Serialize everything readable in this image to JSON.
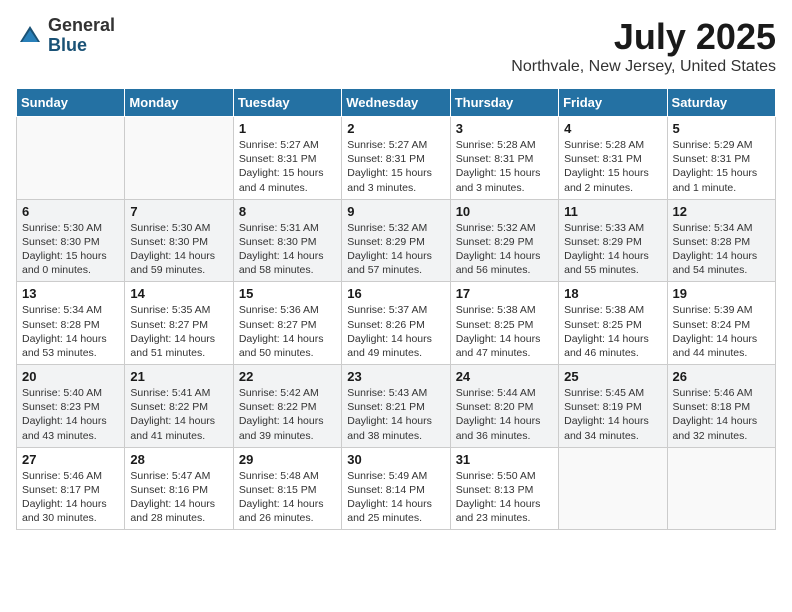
{
  "logo": {
    "general": "General",
    "blue": "Blue"
  },
  "title": "July 2025",
  "location": "Northvale, New Jersey, United States",
  "days_of_week": [
    "Sunday",
    "Monday",
    "Tuesday",
    "Wednesday",
    "Thursday",
    "Friday",
    "Saturday"
  ],
  "weeks": [
    [
      {
        "day": "",
        "info": ""
      },
      {
        "day": "",
        "info": ""
      },
      {
        "day": "1",
        "info": "Sunrise: 5:27 AM\nSunset: 8:31 PM\nDaylight: 15 hours\nand 4 minutes."
      },
      {
        "day": "2",
        "info": "Sunrise: 5:27 AM\nSunset: 8:31 PM\nDaylight: 15 hours\nand 3 minutes."
      },
      {
        "day": "3",
        "info": "Sunrise: 5:28 AM\nSunset: 8:31 PM\nDaylight: 15 hours\nand 3 minutes."
      },
      {
        "day": "4",
        "info": "Sunrise: 5:28 AM\nSunset: 8:31 PM\nDaylight: 15 hours\nand 2 minutes."
      },
      {
        "day": "5",
        "info": "Sunrise: 5:29 AM\nSunset: 8:31 PM\nDaylight: 15 hours\nand 1 minute."
      }
    ],
    [
      {
        "day": "6",
        "info": "Sunrise: 5:30 AM\nSunset: 8:30 PM\nDaylight: 15 hours\nand 0 minutes."
      },
      {
        "day": "7",
        "info": "Sunrise: 5:30 AM\nSunset: 8:30 PM\nDaylight: 14 hours\nand 59 minutes."
      },
      {
        "day": "8",
        "info": "Sunrise: 5:31 AM\nSunset: 8:30 PM\nDaylight: 14 hours\nand 58 minutes."
      },
      {
        "day": "9",
        "info": "Sunrise: 5:32 AM\nSunset: 8:29 PM\nDaylight: 14 hours\nand 57 minutes."
      },
      {
        "day": "10",
        "info": "Sunrise: 5:32 AM\nSunset: 8:29 PM\nDaylight: 14 hours\nand 56 minutes."
      },
      {
        "day": "11",
        "info": "Sunrise: 5:33 AM\nSunset: 8:29 PM\nDaylight: 14 hours\nand 55 minutes."
      },
      {
        "day": "12",
        "info": "Sunrise: 5:34 AM\nSunset: 8:28 PM\nDaylight: 14 hours\nand 54 minutes."
      }
    ],
    [
      {
        "day": "13",
        "info": "Sunrise: 5:34 AM\nSunset: 8:28 PM\nDaylight: 14 hours\nand 53 minutes."
      },
      {
        "day": "14",
        "info": "Sunrise: 5:35 AM\nSunset: 8:27 PM\nDaylight: 14 hours\nand 51 minutes."
      },
      {
        "day": "15",
        "info": "Sunrise: 5:36 AM\nSunset: 8:27 PM\nDaylight: 14 hours\nand 50 minutes."
      },
      {
        "day": "16",
        "info": "Sunrise: 5:37 AM\nSunset: 8:26 PM\nDaylight: 14 hours\nand 49 minutes."
      },
      {
        "day": "17",
        "info": "Sunrise: 5:38 AM\nSunset: 8:25 PM\nDaylight: 14 hours\nand 47 minutes."
      },
      {
        "day": "18",
        "info": "Sunrise: 5:38 AM\nSunset: 8:25 PM\nDaylight: 14 hours\nand 46 minutes."
      },
      {
        "day": "19",
        "info": "Sunrise: 5:39 AM\nSunset: 8:24 PM\nDaylight: 14 hours\nand 44 minutes."
      }
    ],
    [
      {
        "day": "20",
        "info": "Sunrise: 5:40 AM\nSunset: 8:23 PM\nDaylight: 14 hours\nand 43 minutes."
      },
      {
        "day": "21",
        "info": "Sunrise: 5:41 AM\nSunset: 8:22 PM\nDaylight: 14 hours\nand 41 minutes."
      },
      {
        "day": "22",
        "info": "Sunrise: 5:42 AM\nSunset: 8:22 PM\nDaylight: 14 hours\nand 39 minutes."
      },
      {
        "day": "23",
        "info": "Sunrise: 5:43 AM\nSunset: 8:21 PM\nDaylight: 14 hours\nand 38 minutes."
      },
      {
        "day": "24",
        "info": "Sunrise: 5:44 AM\nSunset: 8:20 PM\nDaylight: 14 hours\nand 36 minutes."
      },
      {
        "day": "25",
        "info": "Sunrise: 5:45 AM\nSunset: 8:19 PM\nDaylight: 14 hours\nand 34 minutes."
      },
      {
        "day": "26",
        "info": "Sunrise: 5:46 AM\nSunset: 8:18 PM\nDaylight: 14 hours\nand 32 minutes."
      }
    ],
    [
      {
        "day": "27",
        "info": "Sunrise: 5:46 AM\nSunset: 8:17 PM\nDaylight: 14 hours\nand 30 minutes."
      },
      {
        "day": "28",
        "info": "Sunrise: 5:47 AM\nSunset: 8:16 PM\nDaylight: 14 hours\nand 28 minutes."
      },
      {
        "day": "29",
        "info": "Sunrise: 5:48 AM\nSunset: 8:15 PM\nDaylight: 14 hours\nand 26 minutes."
      },
      {
        "day": "30",
        "info": "Sunrise: 5:49 AM\nSunset: 8:14 PM\nDaylight: 14 hours\nand 25 minutes."
      },
      {
        "day": "31",
        "info": "Sunrise: 5:50 AM\nSunset: 8:13 PM\nDaylight: 14 hours\nand 23 minutes."
      },
      {
        "day": "",
        "info": ""
      },
      {
        "day": "",
        "info": ""
      }
    ]
  ]
}
